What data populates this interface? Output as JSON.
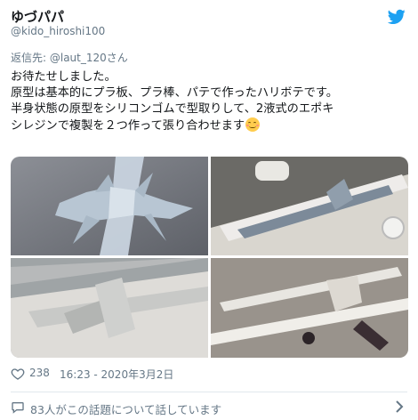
{
  "header": {
    "display_name": "ゆづパパ",
    "handle": "@kido_hiroshi100",
    "logo_icon": "twitter-bird-icon"
  },
  "reply": {
    "prefix": "返信先: ",
    "mention": "@laut_120さん"
  },
  "tweet": {
    "lines": [
      "お待たせしました。",
      "原型は基本的にプラ板、プラ棒、パテで作ったハリボテです。",
      "半身状態の原型をシリコンゴムで型取りして、2液式のエポキ",
      "シレジンで複製を２つ作って張り合わせます"
    ],
    "emoji_icon": "smiling-face-icon"
  },
  "media": {
    "photos": [
      {
        "icon": "photo-sword-prototype"
      },
      {
        "icon": "photo-silicone-mold-sword"
      },
      {
        "icon": "photo-mold-closeup"
      },
      {
        "icon": "photo-resin-parts"
      }
    ]
  },
  "meta": {
    "like_count": "238",
    "timestamp": "16:23 - 2020年3月2日"
  },
  "footer": {
    "text": "83人がこの話題について話しています"
  },
  "colors": {
    "twitter_blue": "#1da1f2",
    "text": "#14171a",
    "secondary": "#657786"
  }
}
